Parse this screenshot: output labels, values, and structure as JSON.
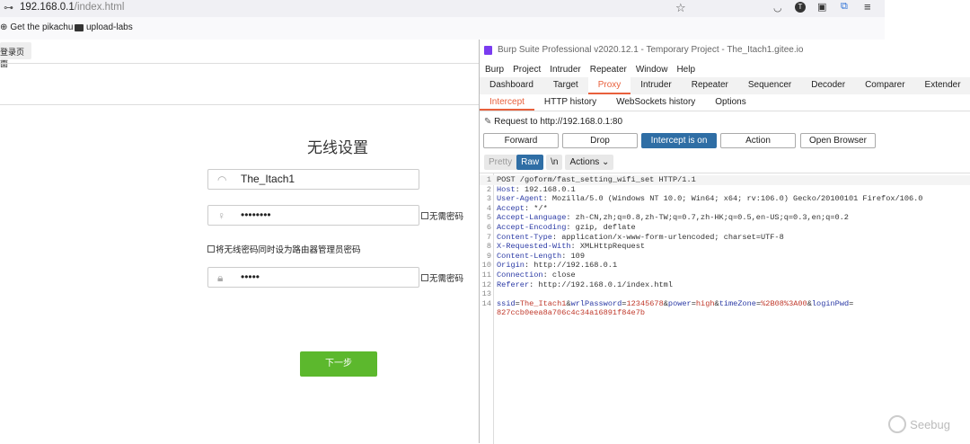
{
  "browser": {
    "url_host": "192.168.0.1",
    "url_path": "/index.html",
    "bookmarks": [
      "Get the pikachu",
      "upload-labs"
    ],
    "page_tab": "登录页面"
  },
  "page": {
    "title": "无线设置",
    "ssid": "The_Itach1",
    "wifi_password": "••••••••",
    "no_password_label": "无需密码",
    "same_password_label": "将无线密码同时设为路由器管理员密码",
    "admin_password": "•••••",
    "admin_no_password_label": "无需密码",
    "next_button": "下一步"
  },
  "burp": {
    "title": "Burp Suite Professional v2020.12.1 - Temporary Project - The_Itach1.gitee.io",
    "menu": [
      "Burp",
      "Project",
      "Intruder",
      "Repeater",
      "Window",
      "Help"
    ],
    "tabs": [
      "Dashboard",
      "Target",
      "Proxy",
      "Intruder",
      "Repeater",
      "Sequencer",
      "Decoder",
      "Comparer",
      "Extender"
    ],
    "subtabs": [
      "Intercept",
      "HTTP history",
      "WebSockets history",
      "Options"
    ],
    "request_to": "Request to http://192.168.0.1:80",
    "buttons": [
      "Forward",
      "Drop",
      "Intercept is on",
      "Action",
      "Open Browser"
    ],
    "view": [
      "Pretty",
      "Raw",
      "\\n",
      "Actions ⌄"
    ],
    "lines": [
      {
        "n": "1",
        "k": "",
        "v": "POST /goform/fast_setting_wifi_set HTTP/1.1"
      },
      {
        "n": "2",
        "k": "Host",
        "v": ": 192.168.0.1"
      },
      {
        "n": "3",
        "k": "User-Agent",
        "v": ": Mozilla/5.0 (Windows NT 10.0; Win64; x64; rv:106.0) Gecko/20100101 Firefox/106.0"
      },
      {
        "n": "4",
        "k": "Accept",
        "v": ": */*"
      },
      {
        "n": "5",
        "k": "Accept-Language",
        "v": ": zh-CN,zh;q=0.8,zh-TW;q=0.7,zh-HK;q=0.5,en-US;q=0.3,en;q=0.2"
      },
      {
        "n": "6",
        "k": "Accept-Encoding",
        "v": ": gzip, deflate"
      },
      {
        "n": "7",
        "k": "Content-Type",
        "v": ": application/x-www-form-urlencoded; charset=UTF-8"
      },
      {
        "n": "8",
        "k": "X-Requested-With",
        "v": ": XMLHttpRequest"
      },
      {
        "n": "9",
        "k": "Content-Length",
        "v": ": 109"
      },
      {
        "n": "10",
        "k": "Origin",
        "v": ": http://192.168.0.1"
      },
      {
        "n": "11",
        "k": "Connection",
        "v": ": close"
      },
      {
        "n": "12",
        "k": "Referer",
        "v": ": http://192.168.0.1/index.html"
      },
      {
        "n": "13",
        "k": "",
        "v": ""
      }
    ],
    "body": {
      "n": "14",
      "params": [
        [
          "ssid",
          "The_Itach1"
        ],
        [
          "wrlPassword",
          "12345678"
        ],
        [
          "power",
          "high"
        ],
        [
          "timeZone",
          "%2B08%3A00"
        ],
        [
          "loginPwd",
          ""
        ]
      ],
      "cont": "827ccb0eea8a706c4c34a16891f84e7b"
    }
  },
  "watermark": "Seebug"
}
